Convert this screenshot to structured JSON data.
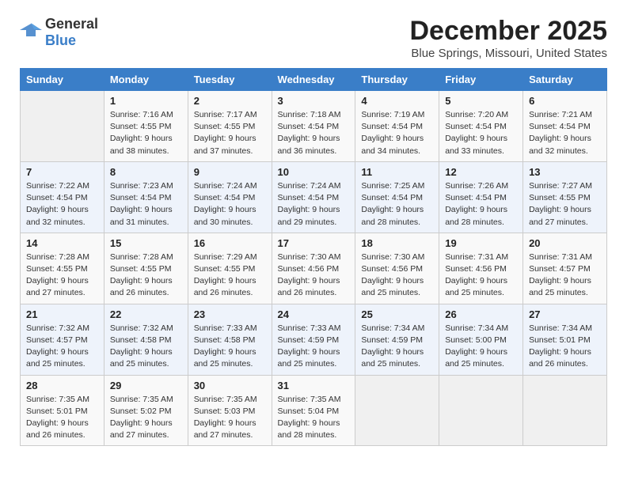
{
  "logo": {
    "general": "General",
    "blue": "Blue"
  },
  "title": "December 2025",
  "subtitle": "Blue Springs, Missouri, United States",
  "days": [
    "Sunday",
    "Monday",
    "Tuesday",
    "Wednesday",
    "Thursday",
    "Friday",
    "Saturday"
  ],
  "weeks": [
    [
      {
        "date": "",
        "sunrise": "",
        "sunset": "",
        "daylight": ""
      },
      {
        "date": "1",
        "sunrise": "Sunrise: 7:16 AM",
        "sunset": "Sunset: 4:55 PM",
        "daylight": "Daylight: 9 hours and 38 minutes."
      },
      {
        "date": "2",
        "sunrise": "Sunrise: 7:17 AM",
        "sunset": "Sunset: 4:55 PM",
        "daylight": "Daylight: 9 hours and 37 minutes."
      },
      {
        "date": "3",
        "sunrise": "Sunrise: 7:18 AM",
        "sunset": "Sunset: 4:54 PM",
        "daylight": "Daylight: 9 hours and 36 minutes."
      },
      {
        "date": "4",
        "sunrise": "Sunrise: 7:19 AM",
        "sunset": "Sunset: 4:54 PM",
        "daylight": "Daylight: 9 hours and 34 minutes."
      },
      {
        "date": "5",
        "sunrise": "Sunrise: 7:20 AM",
        "sunset": "Sunset: 4:54 PM",
        "daylight": "Daylight: 9 hours and 33 minutes."
      },
      {
        "date": "6",
        "sunrise": "Sunrise: 7:21 AM",
        "sunset": "Sunset: 4:54 PM",
        "daylight": "Daylight: 9 hours and 32 minutes."
      }
    ],
    [
      {
        "date": "7",
        "sunrise": "Sunrise: 7:22 AM",
        "sunset": "Sunset: 4:54 PM",
        "daylight": "Daylight: 9 hours and 32 minutes."
      },
      {
        "date": "8",
        "sunrise": "Sunrise: 7:23 AM",
        "sunset": "Sunset: 4:54 PM",
        "daylight": "Daylight: 9 hours and 31 minutes."
      },
      {
        "date": "9",
        "sunrise": "Sunrise: 7:24 AM",
        "sunset": "Sunset: 4:54 PM",
        "daylight": "Daylight: 9 hours and 30 minutes."
      },
      {
        "date": "10",
        "sunrise": "Sunrise: 7:24 AM",
        "sunset": "Sunset: 4:54 PM",
        "daylight": "Daylight: 9 hours and 29 minutes."
      },
      {
        "date": "11",
        "sunrise": "Sunrise: 7:25 AM",
        "sunset": "Sunset: 4:54 PM",
        "daylight": "Daylight: 9 hours and 28 minutes."
      },
      {
        "date": "12",
        "sunrise": "Sunrise: 7:26 AM",
        "sunset": "Sunset: 4:54 PM",
        "daylight": "Daylight: 9 hours and 28 minutes."
      },
      {
        "date": "13",
        "sunrise": "Sunrise: 7:27 AM",
        "sunset": "Sunset: 4:55 PM",
        "daylight": "Daylight: 9 hours and 27 minutes."
      }
    ],
    [
      {
        "date": "14",
        "sunrise": "Sunrise: 7:28 AM",
        "sunset": "Sunset: 4:55 PM",
        "daylight": "Daylight: 9 hours and 27 minutes."
      },
      {
        "date": "15",
        "sunrise": "Sunrise: 7:28 AM",
        "sunset": "Sunset: 4:55 PM",
        "daylight": "Daylight: 9 hours and 26 minutes."
      },
      {
        "date": "16",
        "sunrise": "Sunrise: 7:29 AM",
        "sunset": "Sunset: 4:55 PM",
        "daylight": "Daylight: 9 hours and 26 minutes."
      },
      {
        "date": "17",
        "sunrise": "Sunrise: 7:30 AM",
        "sunset": "Sunset: 4:56 PM",
        "daylight": "Daylight: 9 hours and 26 minutes."
      },
      {
        "date": "18",
        "sunrise": "Sunrise: 7:30 AM",
        "sunset": "Sunset: 4:56 PM",
        "daylight": "Daylight: 9 hours and 25 minutes."
      },
      {
        "date": "19",
        "sunrise": "Sunrise: 7:31 AM",
        "sunset": "Sunset: 4:56 PM",
        "daylight": "Daylight: 9 hours and 25 minutes."
      },
      {
        "date": "20",
        "sunrise": "Sunrise: 7:31 AM",
        "sunset": "Sunset: 4:57 PM",
        "daylight": "Daylight: 9 hours and 25 minutes."
      }
    ],
    [
      {
        "date": "21",
        "sunrise": "Sunrise: 7:32 AM",
        "sunset": "Sunset: 4:57 PM",
        "daylight": "Daylight: 9 hours and 25 minutes."
      },
      {
        "date": "22",
        "sunrise": "Sunrise: 7:32 AM",
        "sunset": "Sunset: 4:58 PM",
        "daylight": "Daylight: 9 hours and 25 minutes."
      },
      {
        "date": "23",
        "sunrise": "Sunrise: 7:33 AM",
        "sunset": "Sunset: 4:58 PM",
        "daylight": "Daylight: 9 hours and 25 minutes."
      },
      {
        "date": "24",
        "sunrise": "Sunrise: 7:33 AM",
        "sunset": "Sunset: 4:59 PM",
        "daylight": "Daylight: 9 hours and 25 minutes."
      },
      {
        "date": "25",
        "sunrise": "Sunrise: 7:34 AM",
        "sunset": "Sunset: 4:59 PM",
        "daylight": "Daylight: 9 hours and 25 minutes."
      },
      {
        "date": "26",
        "sunrise": "Sunrise: 7:34 AM",
        "sunset": "Sunset: 5:00 PM",
        "daylight": "Daylight: 9 hours and 25 minutes."
      },
      {
        "date": "27",
        "sunrise": "Sunrise: 7:34 AM",
        "sunset": "Sunset: 5:01 PM",
        "daylight": "Daylight: 9 hours and 26 minutes."
      }
    ],
    [
      {
        "date": "28",
        "sunrise": "Sunrise: 7:35 AM",
        "sunset": "Sunset: 5:01 PM",
        "daylight": "Daylight: 9 hours and 26 minutes."
      },
      {
        "date": "29",
        "sunrise": "Sunrise: 7:35 AM",
        "sunset": "Sunset: 5:02 PM",
        "daylight": "Daylight: 9 hours and 27 minutes."
      },
      {
        "date": "30",
        "sunrise": "Sunrise: 7:35 AM",
        "sunset": "Sunset: 5:03 PM",
        "daylight": "Daylight: 9 hours and 27 minutes."
      },
      {
        "date": "31",
        "sunrise": "Sunrise: 7:35 AM",
        "sunset": "Sunset: 5:04 PM",
        "daylight": "Daylight: 9 hours and 28 minutes."
      },
      {
        "date": "",
        "sunrise": "",
        "sunset": "",
        "daylight": ""
      },
      {
        "date": "",
        "sunrise": "",
        "sunset": "",
        "daylight": ""
      },
      {
        "date": "",
        "sunrise": "",
        "sunset": "",
        "daylight": ""
      }
    ]
  ]
}
